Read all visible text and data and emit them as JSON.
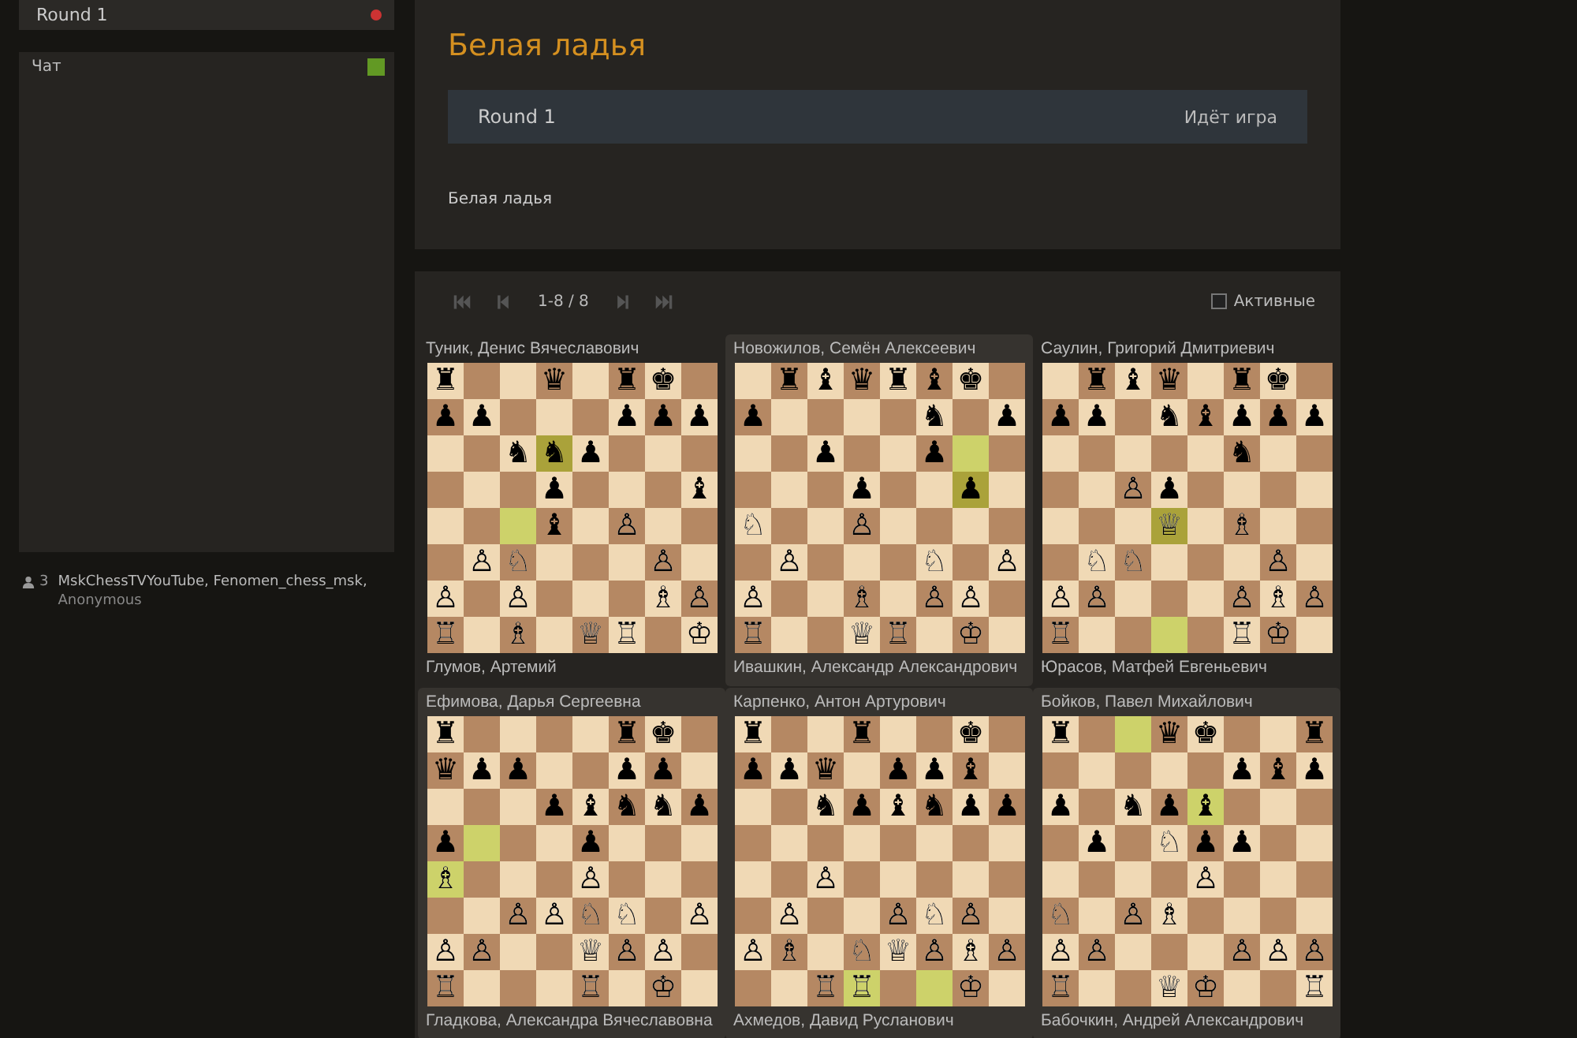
{
  "sidebar": {
    "round": {
      "label": "Round 1",
      "live": true
    },
    "chat": {
      "title": "Чат",
      "enabled": true
    },
    "spectators": {
      "count": "3",
      "names": "MskChessTVYouTube, Fenomen_chess_msk,",
      "more": "Anonymous"
    }
  },
  "header": {
    "title": "Белая ладья",
    "round": {
      "name": "Round 1",
      "status": "Идёт игра"
    },
    "description": "Белая ладья"
  },
  "games_panel": {
    "nav": {
      "range": "1-8 / 8"
    },
    "filter": {
      "label": "Активные",
      "checked": false
    },
    "games": [
      {
        "top": "Туник, Денис Вячеславович",
        "bottom": "Глумов, Артемий",
        "selected": false,
        "board": [
          [
            {
              "piece": "♜",
              "highlighted": false
            },
            {
              "highlighted": false
            },
            {
              "highlighted": false
            },
            {
              "piece": "♛",
              "highlighted": false
            },
            {
              "highlighted": false
            },
            {
              "piece": "♜",
              "highlighted": false
            },
            {
              "piece": "♚",
              "highlighted": false
            },
            {
              "highlighted": false
            }
          ],
          [
            {
              "piece": "♟",
              "highlighted": false
            },
            {
              "piece": "♟",
              "highlighted": false
            },
            {
              "highlighted": false
            },
            {
              "highlighted": false
            },
            {
              "highlighted": false
            },
            {
              "piece": "♟",
              "highlighted": false
            },
            {
              "piece": "♟",
              "highlighted": false
            },
            {
              "piece": "♟",
              "highlighted": false
            }
          ],
          [
            {
              "highlighted": false
            },
            {
              "highlighted": false
            },
            {
              "piece": "♞",
              "highlighted": false
            },
            {
              "piece": "♞",
              "highlighted": true
            },
            {
              "piece": "♟",
              "highlighted": false
            },
            {
              "highlighted": false
            },
            {
              "highlighted": false
            },
            {
              "highlighted": false
            }
          ],
          [
            {
              "highlighted": false
            },
            {
              "highlighted": false
            },
            {
              "highlighted": false
            },
            {
              "piece": "♟",
              "highlighted": false
            },
            {
              "highlighted": false
            },
            {
              "highlighted": false
            },
            {
              "highlighted": false
            },
            {
              "piece": "♝",
              "highlighted": false
            }
          ],
          [
            {
              "highlighted": false
            },
            {
              "highlighted": false
            },
            {
              "highlighted": true
            },
            {
              "piece": "♝",
              "highlighted": false
            },
            {
              "highlighted": false
            },
            {
              "piece": "♙",
              "highlighted": false
            },
            {
              "highlighted": false
            },
            {
              "highlighted": false
            }
          ],
          [
            {
              "highlighted": false
            },
            {
              "piece": "♙",
              "highlighted": false
            },
            {
              "piece": "♘",
              "highlighted": false
            },
            {
              "highlighted": false
            },
            {
              "highlighted": false
            },
            {
              "highlighted": false
            },
            {
              "piece": "♙",
              "highlighted": false
            },
            {
              "highlighted": false
            }
          ],
          [
            {
              "piece": "♙",
              "highlighted": false
            },
            {
              "highlighted": false
            },
            {
              "piece": "♙",
              "highlighted": false
            },
            {
              "highlighted": false
            },
            {
              "highlighted": false
            },
            {
              "highlighted": false
            },
            {
              "piece": "♗",
              "highlighted": false
            },
            {
              "piece": "♙",
              "highlighted": false
            }
          ],
          [
            {
              "piece": "♖",
              "highlighted": false
            },
            {
              "highlighted": false
            },
            {
              "piece": "♗",
              "highlighted": false
            },
            {
              "highlighted": false
            },
            {
              "piece": "♕",
              "highlighted": false
            },
            {
              "piece": "♖",
              "highlighted": false
            },
            {
              "highlighted": false
            },
            {
              "piece": "♔",
              "highlighted": false
            }
          ]
        ]
      },
      {
        "top": "Новожилов, Семён Алексеевич",
        "bottom": "Ивашкин, Александр Александрович",
        "selected": true,
        "board": [
          [
            {
              "highlighted": false
            },
            {
              "piece": "♜",
              "highlighted": false
            },
            {
              "piece": "♝",
              "highlighted": false
            },
            {
              "piece": "♛",
              "highlighted": false
            },
            {
              "piece": "♜",
              "highlighted": false
            },
            {
              "piece": "♝",
              "highlighted": false
            },
            {
              "piece": "♚",
              "highlighted": false
            },
            {
              "highlighted": false
            }
          ],
          [
            {
              "piece": "♟",
              "highlighted": false
            },
            {
              "highlighted": false
            },
            {
              "highlighted": false
            },
            {
              "highlighted": false
            },
            {
              "highlighted": false
            },
            {
              "piece": "♞",
              "highlighted": false
            },
            {
              "highlighted": false
            },
            {
              "piece": "♟",
              "highlighted": false
            }
          ],
          [
            {
              "highlighted": false
            },
            {
              "highlighted": false
            },
            {
              "piece": "♟",
              "highlighted": false
            },
            {
              "highlighted": false
            },
            {
              "highlighted": false
            },
            {
              "piece": "♟",
              "highlighted": false
            },
            {
              "highlighted": true
            },
            {
              "highlighted": false
            }
          ],
          [
            {
              "highlighted": false
            },
            {
              "highlighted": false
            },
            {
              "highlighted": false
            },
            {
              "piece": "♟",
              "highlighted": false
            },
            {
              "highlighted": false
            },
            {
              "highlighted": false
            },
            {
              "piece": "♟",
              "highlighted": true
            },
            {
              "highlighted": false
            }
          ],
          [
            {
              "piece": "♘",
              "highlighted": false
            },
            {
              "highlighted": false
            },
            {
              "highlighted": false
            },
            {
              "piece": "♙",
              "highlighted": false
            },
            {
              "highlighted": false
            },
            {
              "highlighted": false
            },
            {
              "highlighted": false
            },
            {
              "highlighted": false
            }
          ],
          [
            {
              "highlighted": false
            },
            {
              "piece": "♙",
              "highlighted": false
            },
            {
              "highlighted": false
            },
            {
              "highlighted": false
            },
            {
              "highlighted": false
            },
            {
              "piece": "♘",
              "highlighted": false
            },
            {
              "highlighted": false
            },
            {
              "piece": "♙",
              "highlighted": false
            }
          ],
          [
            {
              "piece": "♙",
              "highlighted": false
            },
            {
              "highlighted": false
            },
            {
              "highlighted": false
            },
            {
              "piece": "♗",
              "highlighted": false
            },
            {
              "highlighted": false
            },
            {
              "piece": "♙",
              "highlighted": false
            },
            {
              "piece": "♙",
              "highlighted": false
            },
            {
              "highlighted": false
            }
          ],
          [
            {
              "piece": "♖",
              "highlighted": false
            },
            {
              "highlighted": false
            },
            {
              "highlighted": false
            },
            {
              "piece": "♕",
              "highlighted": false
            },
            {
              "piece": "♖",
              "highlighted": false
            },
            {
              "highlighted": false
            },
            {
              "piece": "♔",
              "highlighted": false
            },
            {
              "highlighted": false
            }
          ]
        ]
      },
      {
        "top": "Саулин, Григорий Дмитриевич",
        "bottom": "Юрасов, Матфей Евгеньевич",
        "selected": false,
        "board": [
          [
            {
              "highlighted": false
            },
            {
              "piece": "♜",
              "highlighted": false
            },
            {
              "piece": "♝",
              "highlighted": false
            },
            {
              "piece": "♛",
              "highlighted": false
            },
            {
              "highlighted": false
            },
            {
              "piece": "♜",
              "highlighted": false
            },
            {
              "piece": "♚",
              "highlighted": false
            },
            {
              "highlighted": false
            }
          ],
          [
            {
              "piece": "♟",
              "highlighted": false
            },
            {
              "piece": "♟",
              "highlighted": false
            },
            {
              "highlighted": false
            },
            {
              "piece": "♞",
              "highlighted": false
            },
            {
              "piece": "♝",
              "highlighted": false
            },
            {
              "piece": "♟",
              "highlighted": false
            },
            {
              "piece": "♟",
              "highlighted": false
            },
            {
              "piece": "♟",
              "highlighted": false
            }
          ],
          [
            {
              "highlighted": false
            },
            {
              "highlighted": false
            },
            {
              "highlighted": false
            },
            {
              "highlighted": false
            },
            {
              "highlighted": false
            },
            {
              "piece": "♞",
              "highlighted": false
            },
            {
              "highlighted": false
            },
            {
              "highlighted": false
            }
          ],
          [
            {
              "highlighted": false
            },
            {
              "highlighted": false
            },
            {
              "piece": "♙",
              "highlighted": false
            },
            {
              "piece": "♟",
              "highlighted": false
            },
            {
              "highlighted": false
            },
            {
              "highlighted": false
            },
            {
              "highlighted": false
            },
            {
              "highlighted": false
            }
          ],
          [
            {
              "highlighted": false
            },
            {
              "highlighted": false
            },
            {
              "highlighted": false
            },
            {
              "piece": "♕",
              "highlighted": true
            },
            {
              "highlighted": false
            },
            {
              "piece": "♗",
              "highlighted": false
            },
            {
              "highlighted": false
            },
            {
              "highlighted": false
            }
          ],
          [
            {
              "highlighted": false
            },
            {
              "piece": "♘",
              "highlighted": false
            },
            {
              "piece": "♘",
              "highlighted": false
            },
            {
              "highlighted": false
            },
            {
              "highlighted": false
            },
            {
              "highlighted": false
            },
            {
              "piece": "♙",
              "highlighted": false
            },
            {
              "highlighted": false
            }
          ],
          [
            {
              "piece": "♙",
              "highlighted": false
            },
            {
              "piece": "♙",
              "highlighted": false
            },
            {
              "highlighted": false
            },
            {
              "highlighted": false
            },
            {
              "highlighted": false
            },
            {
              "piece": "♙",
              "highlighted": false
            },
            {
              "piece": "♗",
              "highlighted": false
            },
            {
              "piece": "♙",
              "highlighted": false
            }
          ],
          [
            {
              "piece": "♖",
              "highlighted": false
            },
            {
              "highlighted": false
            },
            {
              "highlighted": false
            },
            {
              "highlighted": true
            },
            {
              "highlighted": false
            },
            {
              "piece": "♖",
              "highlighted": false
            },
            {
              "piece": "♔",
              "highlighted": false
            },
            {
              "highlighted": false
            }
          ]
        ]
      },
      {
        "top": "Ефимова, Дарья Сергеевна",
        "bottom": "Гладкова, Александра Вячеславовна",
        "selected": true,
        "board": [
          [
            {
              "piece": "♜",
              "highlighted": false
            },
            {
              "highlighted": false
            },
            {
              "highlighted": false
            },
            {
              "highlighted": false
            },
            {
              "highlighted": false
            },
            {
              "piece": "♜",
              "highlighted": false
            },
            {
              "piece": "♚",
              "highlighted": false
            },
            {
              "highlighted": false
            }
          ],
          [
            {
              "piece": "♛",
              "highlighted": false
            },
            {
              "piece": "♟",
              "highlighted": false
            },
            {
              "piece": "♟",
              "highlighted": false
            },
            {
              "highlighted": false
            },
            {
              "highlighted": false
            },
            {
              "piece": "♟",
              "highlighted": false
            },
            {
              "piece": "♟",
              "highlighted": false
            },
            {
              "highlighted": false
            }
          ],
          [
            {
              "highlighted": false
            },
            {
              "highlighted": false
            },
            {
              "highlighted": false
            },
            {
              "piece": "♟",
              "highlighted": false
            },
            {
              "piece": "♝",
              "highlighted": false
            },
            {
              "piece": "♞",
              "highlighted": false
            },
            {
              "piece": "♞",
              "highlighted": false
            },
            {
              "piece": "♟",
              "highlighted": false
            }
          ],
          [
            {
              "piece": "♟",
              "highlighted": false
            },
            {
              "highlighted": true
            },
            {
              "highlighted": false
            },
            {
              "highlighted": false
            },
            {
              "piece": "♟",
              "highlighted": false
            },
            {
              "highlighted": false
            },
            {
              "highlighted": false
            },
            {
              "highlighted": false
            }
          ],
          [
            {
              "piece": "♗",
              "highlighted": true
            },
            {
              "highlighted": false
            },
            {
              "highlighted": false
            },
            {
              "highlighted": false
            },
            {
              "piece": "♙",
              "highlighted": false
            },
            {
              "highlighted": false
            },
            {
              "highlighted": false
            },
            {
              "highlighted": false
            }
          ],
          [
            {
              "highlighted": false
            },
            {
              "highlighted": false
            },
            {
              "piece": "♙",
              "highlighted": false
            },
            {
              "piece": "♙",
              "highlighted": false
            },
            {
              "piece": "♘",
              "highlighted": false
            },
            {
              "piece": "♘",
              "highlighted": false
            },
            {
              "highlighted": false
            },
            {
              "piece": "♙",
              "highlighted": false
            }
          ],
          [
            {
              "piece": "♙",
              "highlighted": false
            },
            {
              "piece": "♙",
              "highlighted": false
            },
            {
              "highlighted": false
            },
            {
              "highlighted": false
            },
            {
              "piece": "♕",
              "highlighted": false
            },
            {
              "piece": "♙",
              "highlighted": false
            },
            {
              "piece": "♙",
              "highlighted": false
            },
            {
              "highlighted": false
            }
          ],
          [
            {
              "piece": "♖",
              "highlighted": false
            },
            {
              "highlighted": false
            },
            {
              "highlighted": false
            },
            {
              "highlighted": false
            },
            {
              "piece": "♖",
              "highlighted": false
            },
            {
              "highlighted": false
            },
            {
              "piece": "♔",
              "highlighted": false
            },
            {
              "highlighted": false
            }
          ]
        ]
      },
      {
        "top": "Карпенко, Антон Артурович",
        "bottom": "Ахмедов, Давид Русланович",
        "selected": true,
        "board": [
          [
            {
              "piece": "♜",
              "highlighted": false
            },
            {
              "highlighted": false
            },
            {
              "highlighted": false
            },
            {
              "piece": "♜",
              "highlighted": false
            },
            {
              "highlighted": false
            },
            {
              "highlighted": false
            },
            {
              "piece": "♚",
              "highlighted": false
            },
            {
              "highlighted": false
            }
          ],
          [
            {
              "piece": "♟",
              "highlighted": false
            },
            {
              "piece": "♟",
              "highlighted": false
            },
            {
              "piece": "♛",
              "highlighted": false
            },
            {
              "highlighted": false
            },
            {
              "piece": "♟",
              "highlighted": false
            },
            {
              "piece": "♟",
              "highlighted": false
            },
            {
              "piece": "♝",
              "highlighted": false
            },
            {
              "highlighted": false
            }
          ],
          [
            {
              "highlighted": false
            },
            {
              "highlighted": false
            },
            {
              "piece": "♞",
              "highlighted": false
            },
            {
              "piece": "♟",
              "highlighted": false
            },
            {
              "piece": "♝",
              "highlighted": false
            },
            {
              "piece": "♞",
              "highlighted": false
            },
            {
              "piece": "♟",
              "highlighted": false
            },
            {
              "piece": "♟",
              "highlighted": false
            }
          ],
          [
            {
              "highlighted": false
            },
            {
              "highlighted": false
            },
            {
              "highlighted": false
            },
            {
              "highlighted": false
            },
            {
              "highlighted": false
            },
            {
              "highlighted": false
            },
            {
              "highlighted": false
            },
            {
              "highlighted": false
            }
          ],
          [
            {
              "highlighted": false
            },
            {
              "highlighted": false
            },
            {
              "piece": "♙",
              "highlighted": false
            },
            {
              "highlighted": false
            },
            {
              "highlighted": false
            },
            {
              "highlighted": false
            },
            {
              "highlighted": false
            },
            {
              "highlighted": false
            }
          ],
          [
            {
              "highlighted": false
            },
            {
              "piece": "♙",
              "highlighted": false
            },
            {
              "highlighted": false
            },
            {
              "highlighted": false
            },
            {
              "piece": "♙",
              "highlighted": false
            },
            {
              "piece": "♘",
              "highlighted": false
            },
            {
              "piece": "♙",
              "highlighted": false
            },
            {
              "highlighted": false
            }
          ],
          [
            {
              "piece": "♙",
              "highlighted": false
            },
            {
              "piece": "♗",
              "highlighted": false
            },
            {
              "highlighted": false
            },
            {
              "piece": "♘",
              "highlighted": false
            },
            {
              "piece": "♕",
              "highlighted": false
            },
            {
              "piece": "♙",
              "highlighted": false
            },
            {
              "piece": "♗",
              "highlighted": false
            },
            {
              "piece": "♙",
              "highlighted": false
            }
          ],
          [
            {
              "highlighted": false
            },
            {
              "highlighted": false
            },
            {
              "piece": "♖",
              "highlighted": false
            },
            {
              "piece": "♖",
              "highlighted": true
            },
            {
              "highlighted": false
            },
            {
              "highlighted": true
            },
            {
              "piece": "♔",
              "highlighted": false
            },
            {
              "highlighted": false
            }
          ]
        ]
      },
      {
        "top": "Бойков, Павел Михайлович",
        "bottom": "Бабочкин, Андрей Александрович",
        "selected": true,
        "board": [
          [
            {
              "piece": "♜",
              "highlighted": false
            },
            {
              "highlighted": false
            },
            {
              "highlighted": true
            },
            {
              "piece": "♛",
              "highlighted": false
            },
            {
              "piece": "♚",
              "highlighted": false
            },
            {
              "highlighted": false
            },
            {
              "highlighted": false
            },
            {
              "piece": "♜",
              "highlighted": false
            }
          ],
          [
            {
              "highlighted": false
            },
            {
              "highlighted": false
            },
            {
              "highlighted": false
            },
            {
              "highlighted": false
            },
            {
              "highlighted": false
            },
            {
              "piece": "♟",
              "highlighted": false
            },
            {
              "piece": "♝",
              "highlighted": false
            },
            {
              "piece": "♟",
              "highlighted": false
            }
          ],
          [
            {
              "piece": "♟",
              "highlighted": false
            },
            {
              "highlighted": false
            },
            {
              "piece": "♞",
              "highlighted": false
            },
            {
              "piece": "♟",
              "highlighted": false
            },
            {
              "piece": "♝",
              "highlighted": true
            },
            {
              "highlighted": false
            },
            {
              "highlighted": false
            },
            {
              "highlighted": false
            }
          ],
          [
            {
              "highlighted": false
            },
            {
              "piece": "♟",
              "highlighted": false
            },
            {
              "highlighted": false
            },
            {
              "piece": "♘",
              "highlighted": false
            },
            {
              "piece": "♟",
              "highlighted": false
            },
            {
              "piece": "♟",
              "highlighted": false
            },
            {
              "highlighted": false
            },
            {
              "highlighted": false
            }
          ],
          [
            {
              "highlighted": false
            },
            {
              "highlighted": false
            },
            {
              "highlighted": false
            },
            {
              "highlighted": false
            },
            {
              "piece": "♙",
              "highlighted": false
            },
            {
              "highlighted": false
            },
            {
              "highlighted": false
            },
            {
              "highlighted": false
            }
          ],
          [
            {
              "piece": "♘",
              "highlighted": false
            },
            {
              "highlighted": false
            },
            {
              "piece": "♙",
              "highlighted": false
            },
            {
              "piece": "♗",
              "highlighted": false
            },
            {
              "highlighted": false
            },
            {
              "highlighted": false
            },
            {
              "highlighted": false
            },
            {
              "highlighted": false
            }
          ],
          [
            {
              "piece": "♙",
              "highlighted": false
            },
            {
              "piece": "♙",
              "highlighted": false
            },
            {
              "highlighted": false
            },
            {
              "highlighted": false
            },
            {
              "highlighted": false
            },
            {
              "piece": "♙",
              "highlighted": false
            },
            {
              "piece": "♙",
              "highlighted": false
            },
            {
              "piece": "♙",
              "highlighted": false
            }
          ],
          [
            {
              "piece": "♖",
              "highlighted": false
            },
            {
              "highlighted": false
            },
            {
              "highlighted": false
            },
            {
              "piece": "♕",
              "highlighted": false
            },
            {
              "piece": "♔",
              "highlighted": false
            },
            {
              "highlighted": false
            },
            {
              "highlighted": false
            },
            {
              "piece": "♖",
              "highlighted": false
            }
          ]
        ]
      }
    ]
  }
}
